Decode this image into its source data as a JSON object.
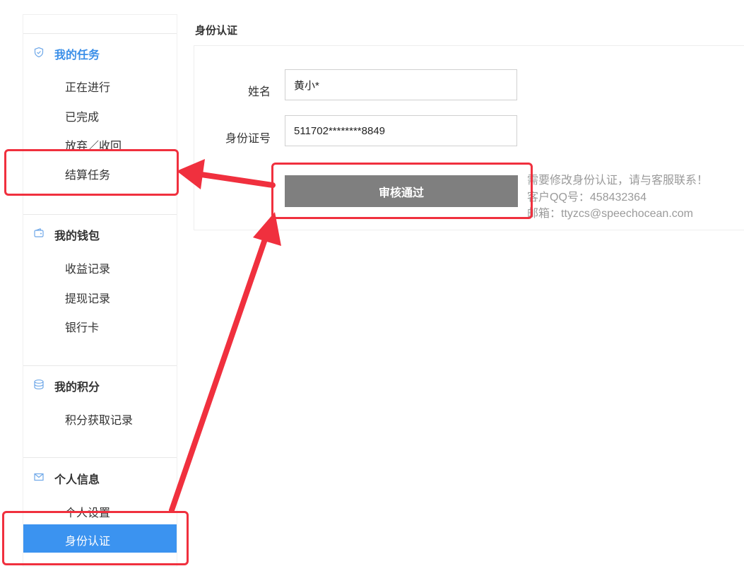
{
  "sidebar": {
    "sections": [
      {
        "icon": "shield-icon",
        "label": "我的任务",
        "items": [
          "正在进行",
          "已完成",
          "放弃／收回",
          "结算任务"
        ]
      },
      {
        "icon": "wallet-icon",
        "label": "我的钱包",
        "items": [
          "收益记录",
          "提现记录",
          "银行卡"
        ]
      },
      {
        "icon": "coins-icon",
        "label": "我的积分",
        "items": [
          "积分获取记录"
        ]
      },
      {
        "icon": "mail-icon",
        "label": "个人信息",
        "items": [
          "个人设置",
          "身份认证"
        ]
      }
    ],
    "selected_item": "身份认证",
    "active_section": "我的任务"
  },
  "main": {
    "title": "身份认证",
    "form": {
      "name_label": "姓名",
      "name_value": "黄小*",
      "id_label": "身份证号",
      "id_value": "511702********8849",
      "status_button": "审核通过"
    },
    "notes": {
      "line1": "需要修改身份认证，请与客服联系！",
      "line2": "客户QQ号：458432364",
      "line3": "邮箱：ttyzcs@speechocean.com"
    }
  },
  "colors": {
    "accent": "#3b8fe8",
    "selected_bg": "#3b93f0",
    "button_bg": "#7f7f7f",
    "annotation": "#f0303e"
  }
}
